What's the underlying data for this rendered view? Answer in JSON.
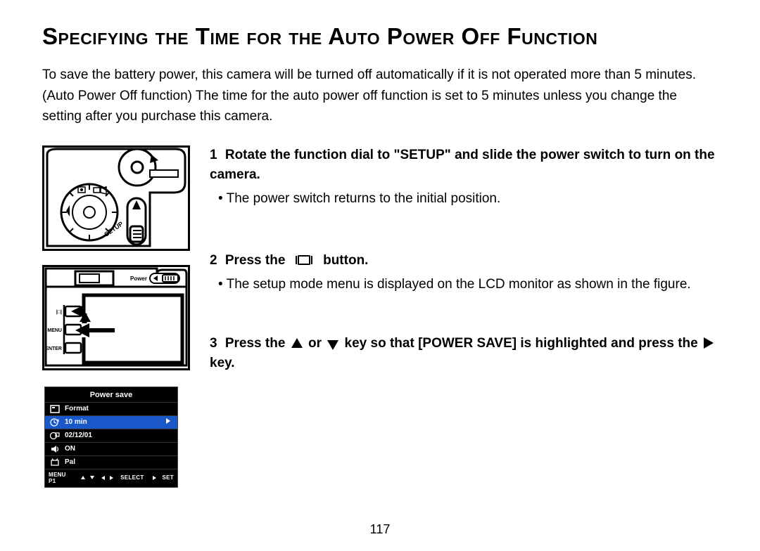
{
  "title": "Specifying the Time for the Auto Power Off Function",
  "intro": "To save the battery power, this camera will be turned off automatically if it is not operated more than 5 minutes. (Auto Power Off function) The time for the auto power off function is set to 5 minutes unless you change the setting after you purchase this camera.",
  "steps": {
    "s1": {
      "num": "1",
      "head": "Rotate the function dial to \"SETUP\" and slide the power switch to turn on the camera.",
      "bullet1": "The power switch returns to the initial position."
    },
    "s2": {
      "num": "2",
      "head_before": "Press the",
      "head_after": "button.",
      "bullet1": "The setup mode menu is displayed on the LCD monitor as shown in the figure."
    },
    "s3": {
      "num": "3",
      "head_a": "Press the",
      "head_b": "or",
      "head_c": "key so that [POWER SAVE] is highlight­ed and press the",
      "head_d": "key."
    }
  },
  "fig1_labels": {
    "setup": "SETUP"
  },
  "fig2_labels": {
    "power": "Power",
    "display_btn": "|□|",
    "menu": "MENU",
    "enter": "ENTER"
  },
  "menu3": {
    "title": "Power save",
    "rows": [
      {
        "icon": "card",
        "label": "Format"
      },
      {
        "icon": "clock",
        "label": "10 min",
        "selected": true,
        "has_key": true
      },
      {
        "icon": "cal",
        "label": "02/12/01"
      },
      {
        "icon": "speaker",
        "label": "ON"
      },
      {
        "icon": "tv",
        "label": "Pal"
      }
    ],
    "hint": {
      "page": "MENU P1",
      "select": "SELECT",
      "set": "SET"
    }
  },
  "page_number": "117"
}
